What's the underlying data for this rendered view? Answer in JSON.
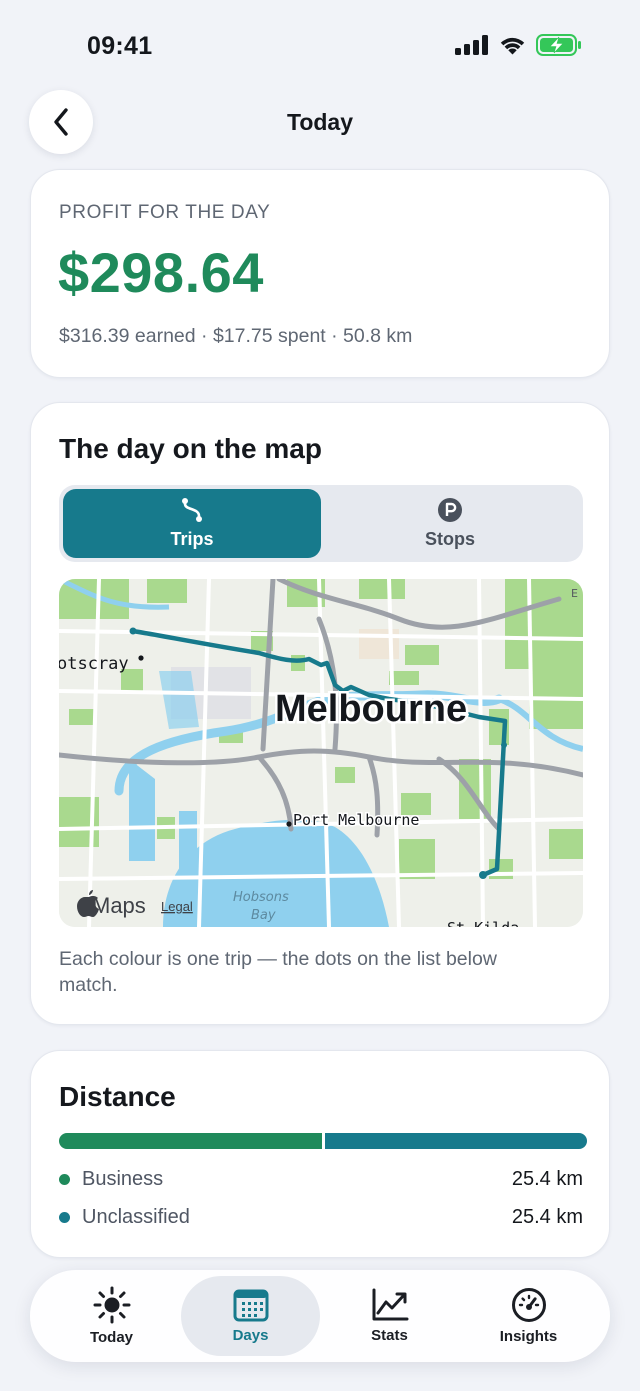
{
  "status_bar": {
    "time": "09:41"
  },
  "header": {
    "title": "Today"
  },
  "profit": {
    "label": "PROFIT FOR THE DAY",
    "value": "$298.64",
    "summary": "$316.39 earned · $17.75 spent · 50.8 km"
  },
  "map_section": {
    "title": "The day on the map",
    "tabs": [
      {
        "label": "Trips",
        "icon": "route-icon",
        "selected": true
      },
      {
        "label": "Stops",
        "icon": "parking-icon",
        "selected": false
      }
    ],
    "labels": {
      "city": "Melbourne",
      "suburb_left": "otscray",
      "port": "Port Melbourne",
      "bay_line1": "Hobsons",
      "bay_line2": "Bay",
      "stkilda": "St Kilda",
      "edge": "E",
      "maps_brand": "Maps",
      "legal": "Legal"
    },
    "caption": "Each colour is one trip — the dots on the list below match.",
    "route_color": "#177a8c"
  },
  "distance": {
    "title": "Distance",
    "business_fraction": 0.5,
    "rows": [
      {
        "label": "Business",
        "value": "25.4 km",
        "color": "#1f8a5b"
      },
      {
        "label": "Unclassified",
        "value": "25.4 km",
        "color": "#177a8c"
      }
    ]
  },
  "tab_bar": {
    "items": [
      {
        "label": "Today",
        "icon": "sun-icon",
        "selected": false
      },
      {
        "label": "Days",
        "icon": "calendar-icon",
        "selected": true
      },
      {
        "label": "Stats",
        "icon": "chart-icon",
        "selected": false
      },
      {
        "label": "Insights",
        "icon": "gauge-icon",
        "selected": false
      }
    ]
  }
}
